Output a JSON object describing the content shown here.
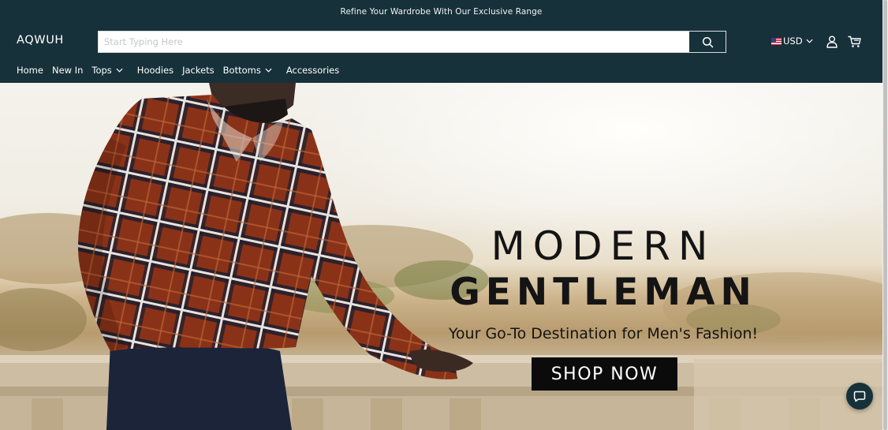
{
  "announcement": "Refine Your Wardrobe With Our Exclusive Range",
  "brand": {
    "logo": "AQWUH"
  },
  "search": {
    "placeholder": "Start Typing Here",
    "value": "",
    "icon": "search-icon"
  },
  "currency": {
    "flag": "us-flag-icon",
    "code": "USD"
  },
  "header_icons": {
    "account": "user-icon",
    "cart": "cart-icon"
  },
  "nav": {
    "items": [
      {
        "label": "Home",
        "dropdown": false
      },
      {
        "label": "New In",
        "dropdown": false
      },
      {
        "label": "Tops",
        "dropdown": true
      },
      {
        "label": "Hoodies",
        "dropdown": false
      },
      {
        "label": "Jackets",
        "dropdown": false
      },
      {
        "label": "Bottoms",
        "dropdown": true
      },
      {
        "label": "Accessories",
        "dropdown": false
      }
    ]
  },
  "hero": {
    "title_line1": "MODERN",
    "title_line2": "GENTLEMAN",
    "subtitle": "Your Go-To Destination for Men's Fashion!",
    "cta": "SHOP NOW"
  },
  "chat": {
    "icon": "chat-bubble-icon"
  },
  "colors": {
    "header_bg": "#17313a",
    "cta_bg": "#0b0b0b",
    "shirt_red": "#8a3218",
    "pants_navy": "#1b2439"
  }
}
